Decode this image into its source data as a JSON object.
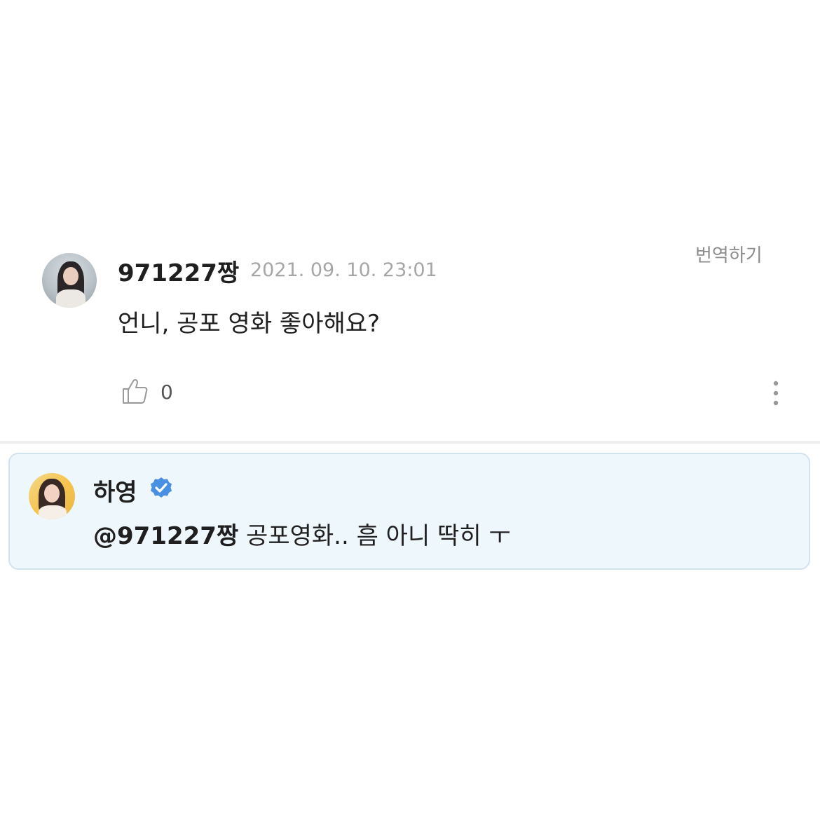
{
  "comment": {
    "username": "971227짱",
    "timestamp": "2021. 09. 10. 23:01",
    "translate_label": "번역하기",
    "text": "언니, 공포 영화 좋아해요?",
    "like_count": "0",
    "avatar_icon": "user-avatar-photo"
  },
  "reply": {
    "username": "하영",
    "verified_icon": "verified-badge",
    "mention": "@971227짱",
    "text": " 공포영화.. 흠 아니 딱히 ㅜ",
    "avatar_icon": "artist-avatar-photo",
    "background_color": "#eef7fc",
    "badge_color": "#4a90e2"
  },
  "icons": {
    "like": "thumbs-up-icon",
    "more": "more-vertical-icon"
  }
}
